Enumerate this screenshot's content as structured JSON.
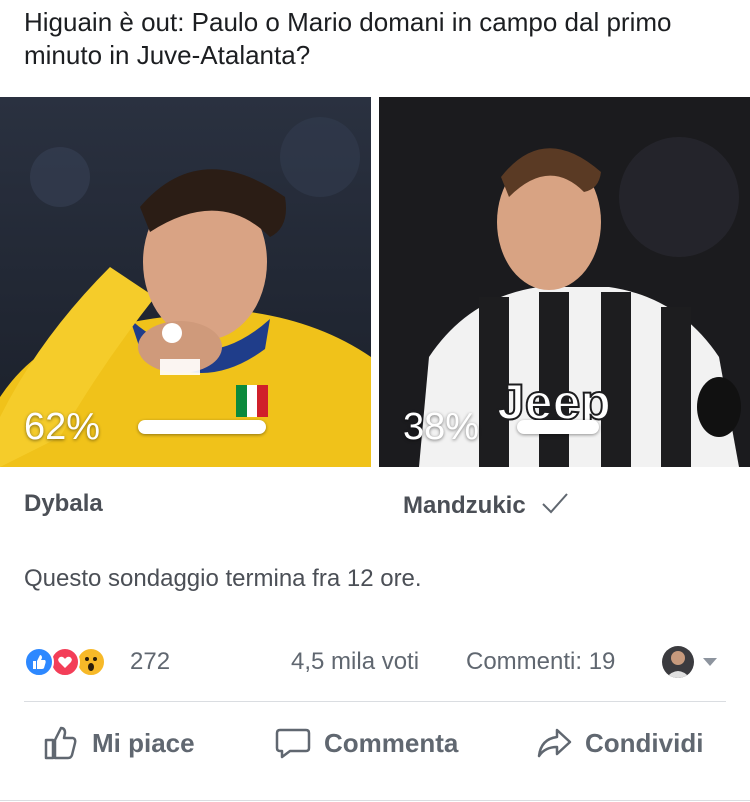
{
  "question": "Higuain è out: Paulo o Mario domani in campo dal primo minuto in Juve-Atalanta?",
  "options": [
    {
      "name": "Dybala",
      "percent_label": "62%",
      "percent": 62,
      "selected": false
    },
    {
      "name": "Mandzukic",
      "percent_label": "38%",
      "percent": 38,
      "selected": true
    }
  ],
  "poll_end_text": "Questo sondaggio termina fra 12 ore.",
  "stats": {
    "reaction_icons": [
      "like-icon",
      "love-icon",
      "wow-icon"
    ],
    "reaction_count": "272",
    "votes": "4,5 mila voti",
    "comments": "Commenti: 19"
  },
  "actions": [
    {
      "label": "Mi piace",
      "icon": "thumbs-up-icon"
    },
    {
      "label": "Commenta",
      "icon": "comment-icon"
    },
    {
      "label": "Condividi",
      "icon": "share-icon"
    }
  ],
  "colors": {
    "like": "#2d88ff",
    "love": "#f33e58",
    "wow": "#f7b928",
    "text_muted": "#606770"
  }
}
